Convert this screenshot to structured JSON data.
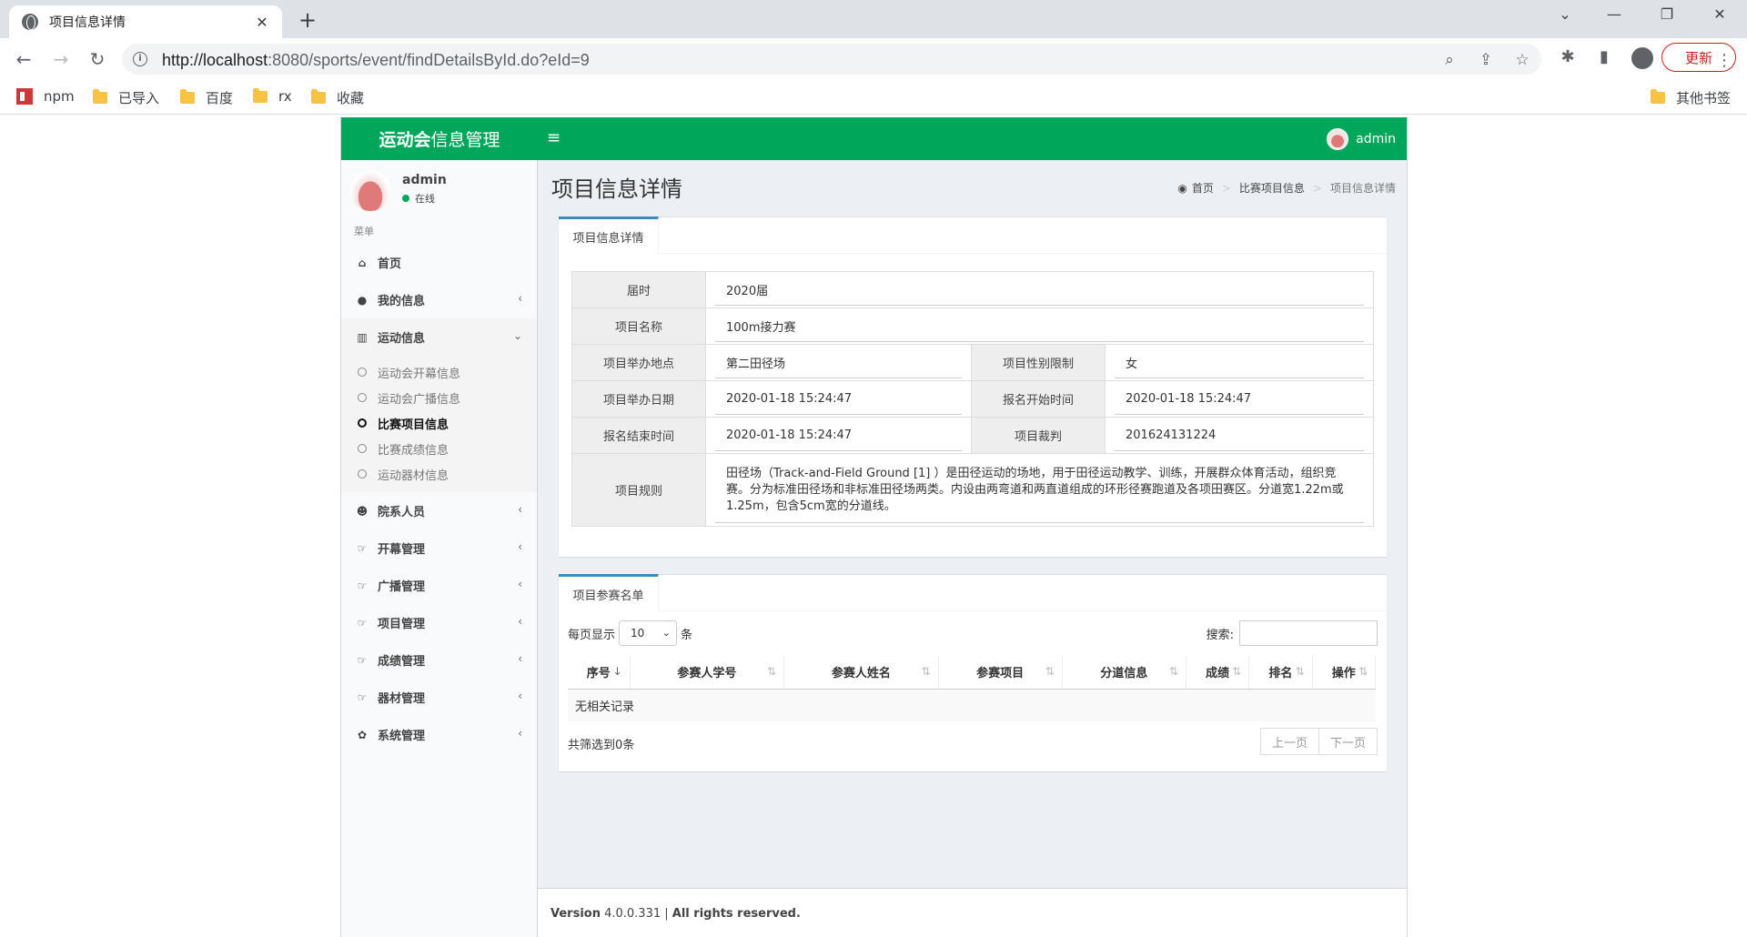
{
  "browser": {
    "tab_title": "项目信息详情",
    "url_host": "http://localhost",
    "url_rest": ":8080/sports/event/findDetailsById.do?eId=9",
    "update_label": "更新",
    "bookmarks": [
      "npm",
      "已导入",
      "百度",
      "rx",
      "收藏"
    ],
    "other_bookmarks": "其他书签"
  },
  "header": {
    "logo_bold": "运动会",
    "logo_rest": "信息管理",
    "user": "admin"
  },
  "sidebar": {
    "user_name": "admin",
    "status": "在线",
    "menu_header": "菜单",
    "items": [
      {
        "label": "首页",
        "icon": "home-icon"
      },
      {
        "label": "我的信息",
        "icon": "user-icon"
      },
      {
        "label": "运动信息",
        "icon": "bar-chart-icon"
      },
      {
        "label": "院系人员",
        "icon": "users-icon"
      },
      {
        "label": "开幕管理",
        "icon": "thumbs-up-icon"
      },
      {
        "label": "广播管理",
        "icon": "thumbs-up-icon"
      },
      {
        "label": "项目管理",
        "icon": "thumbs-up-icon"
      },
      {
        "label": "成绩管理",
        "icon": "thumbs-up-icon"
      },
      {
        "label": "器材管理",
        "icon": "thumbs-up-icon"
      },
      {
        "label": "系统管理",
        "icon": "gear-icon"
      }
    ],
    "sub_items": [
      "运动会开幕信息",
      "运动会广播信息",
      "比赛项目信息",
      "比赛成绩信息",
      "运动器材信息"
    ]
  },
  "page": {
    "title": "项目信息详情",
    "breadcrumb": [
      "首页",
      "比赛项目信息",
      "项目信息详情"
    ]
  },
  "detail": {
    "tab": "项目信息详情",
    "session_label": "届时",
    "session_value": "2020届",
    "name_label": "项目名称",
    "name_value": "100m接力赛",
    "place_label": "项目举办地点",
    "place_value": "第二田径场",
    "gender_label": "项目性别限制",
    "gender_value": "女",
    "date_label": "项目举办日期",
    "date_value": "2020-01-18 15:24:47",
    "reg_start_label": "报名开始时间",
    "reg_start_value": "2020-01-18 15:24:47",
    "reg_end_label": "报名结束时间",
    "reg_end_value": "2020-01-18 15:24:47",
    "referee_label": "项目裁判",
    "referee_value": "201624131224",
    "rules_label": "项目规则",
    "rules_value": "田径场（Track-and-Field Ground [1] ）是田径运动的场地，用于田径运动教学、训练，开展群众体育活动，组织竞赛。分为标准田径场和非标准田径场两类。内设由两弯道和两直道组成的环形径赛跑道及各项田赛区。分道宽1.22m或1.25m，包含5cm宽的分道线。"
  },
  "participants": {
    "tab": "项目参赛名单",
    "length_prefix": "每页显示",
    "length_value": "10",
    "length_suffix": "条",
    "search_label": "搜索:",
    "columns": [
      "序号",
      "参赛人学号",
      "参赛人姓名",
      "参赛项目",
      "分道信息",
      "成绩",
      "排名",
      "操作"
    ],
    "empty_text": "无相关记录",
    "info": "共筛选到0条",
    "prev": "上一页",
    "next": "下一页"
  },
  "footer": {
    "version_label": "Version",
    "version": " 4.0.0.331 | ",
    "rights": "All rights reserved."
  }
}
